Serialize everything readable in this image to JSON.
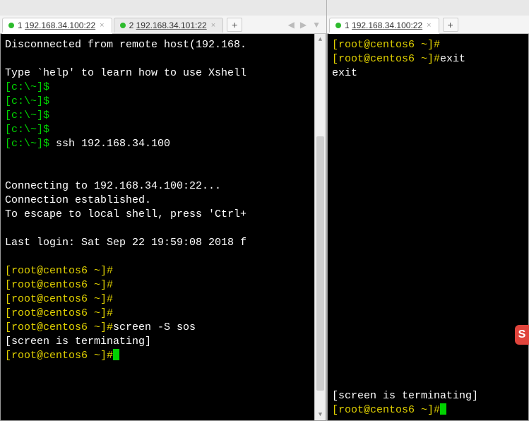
{
  "left": {
    "tabs": [
      {
        "dot": true,
        "index": "1",
        "label": "192.168.34.100:22",
        "active": true
      },
      {
        "dot": true,
        "index": "2",
        "label": "192.168.34.101:22",
        "active": false
      }
    ],
    "scroll": {
      "thumb_top_pct": 25,
      "thumb_height_pct": 70
    },
    "lines": [
      {
        "segs": [
          {
            "cls": "white",
            "t": "Disconnected from remote host(192.168."
          }
        ]
      },
      {
        "segs": []
      },
      {
        "segs": [
          {
            "cls": "white",
            "t": "Type `help' to learn how to use Xshell"
          }
        ]
      },
      {
        "segs": [
          {
            "cls": "green",
            "t": "[c:\\~]$"
          }
        ]
      },
      {
        "segs": [
          {
            "cls": "green",
            "t": "[c:\\~]$"
          }
        ]
      },
      {
        "segs": [
          {
            "cls": "green",
            "t": "[c:\\~]$"
          }
        ]
      },
      {
        "segs": [
          {
            "cls": "green",
            "t": "[c:\\~]$"
          }
        ]
      },
      {
        "segs": [
          {
            "cls": "green",
            "t": "[c:\\~]$ "
          },
          {
            "cls": "white",
            "t": "ssh 192.168.34.100"
          }
        ]
      },
      {
        "segs": []
      },
      {
        "segs": []
      },
      {
        "segs": [
          {
            "cls": "white",
            "t": "Connecting to 192.168.34.100:22..."
          }
        ]
      },
      {
        "segs": [
          {
            "cls": "white",
            "t": "Connection established."
          }
        ]
      },
      {
        "segs": [
          {
            "cls": "white",
            "t": "To escape to local shell, press 'Ctrl+"
          }
        ]
      },
      {
        "segs": []
      },
      {
        "segs": [
          {
            "cls": "white",
            "t": "Last login: Sat Sep 22 19:59:08 2018 f"
          }
        ]
      },
      {
        "segs": []
      },
      {
        "segs": [
          {
            "cls": "yellow",
            "t": "[root@centos6 ~]#"
          }
        ]
      },
      {
        "segs": [
          {
            "cls": "yellow",
            "t": "[root@centos6 ~]#"
          }
        ]
      },
      {
        "segs": [
          {
            "cls": "yellow",
            "t": "[root@centos6 ~]#"
          }
        ]
      },
      {
        "segs": [
          {
            "cls": "yellow",
            "t": "[root@centos6 ~]#"
          }
        ]
      },
      {
        "segs": [
          {
            "cls": "yellow",
            "t": "[root@centos6 ~]#"
          },
          {
            "cls": "white",
            "t": "screen -S sos"
          }
        ]
      },
      {
        "segs": [
          {
            "cls": "white",
            "t": "[screen is terminating]"
          }
        ]
      },
      {
        "segs": [
          {
            "cls": "yellow",
            "t": "[root@centos6 ~]#"
          },
          {
            "cursor": true
          }
        ]
      }
    ]
  },
  "right": {
    "tabs": [
      {
        "dot": true,
        "index": "1",
        "label": "192.168.34.100:22",
        "active": true
      }
    ],
    "lines_top": [
      {
        "segs": [
          {
            "cls": "yellow",
            "t": "[root@centos6 ~]#"
          }
        ]
      },
      {
        "segs": [
          {
            "cls": "yellow",
            "t": "[root@centos6 ~]#"
          },
          {
            "cls": "white",
            "t": "exit"
          }
        ]
      },
      {
        "segs": [
          {
            "cls": "white",
            "t": "exit"
          }
        ]
      }
    ],
    "lines_bottom": [
      {
        "segs": [
          {
            "cls": "white",
            "t": "[screen is terminating]"
          }
        ]
      },
      {
        "segs": [
          {
            "cls": "yellow",
            "t": "[root@centos6 ~]#"
          },
          {
            "cursor": true
          }
        ]
      }
    ]
  },
  "badge": {
    "letter": "S"
  },
  "glyphs": {
    "plus": "+",
    "close": "×",
    "tri_left": "◀",
    "tri_right": "▶",
    "tri_down": "▼",
    "tri_up": "▲"
  }
}
